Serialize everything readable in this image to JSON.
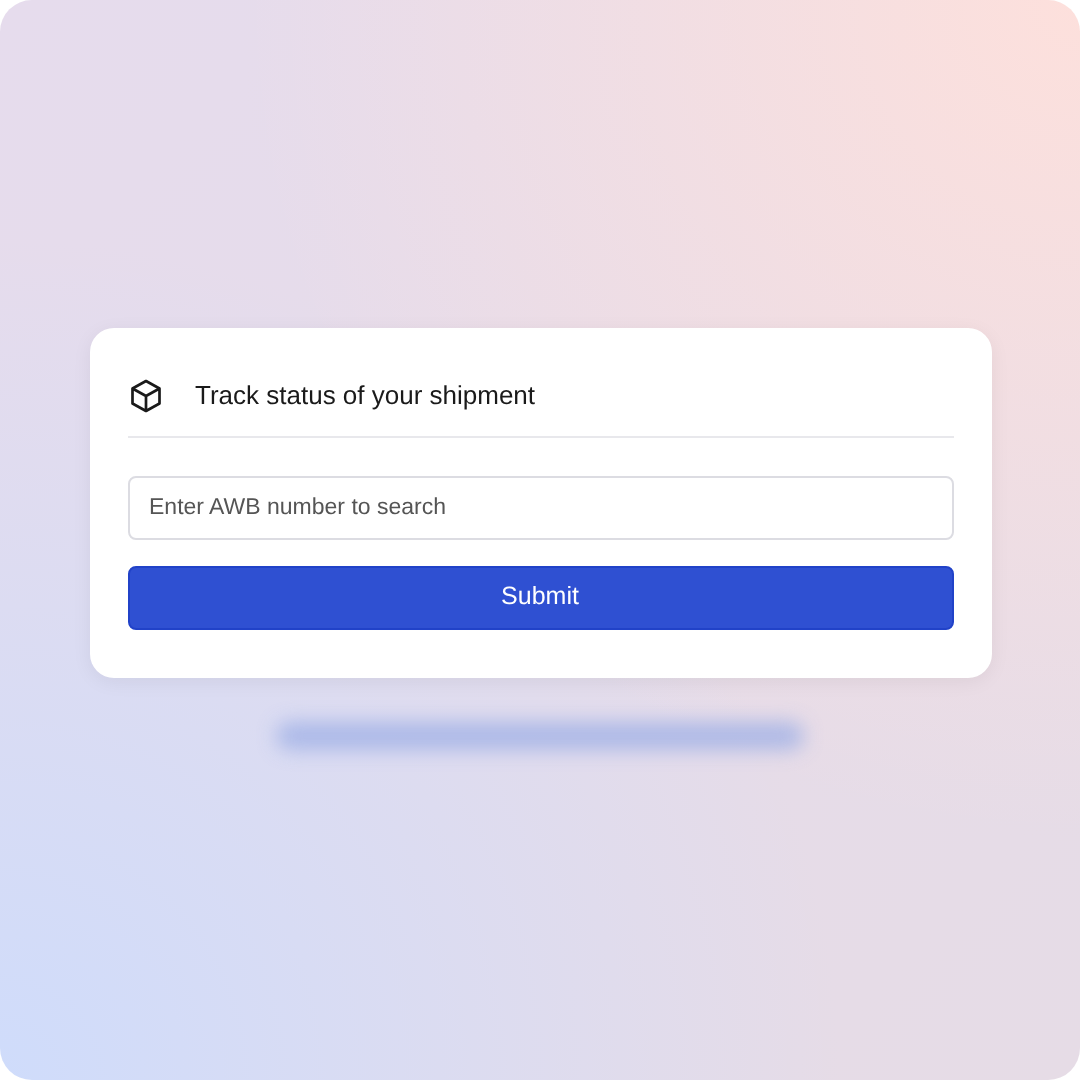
{
  "card": {
    "title": "Track status of your shipment"
  },
  "search": {
    "placeholder": "Enter AWB number to search"
  },
  "button": {
    "label": "Submit"
  }
}
